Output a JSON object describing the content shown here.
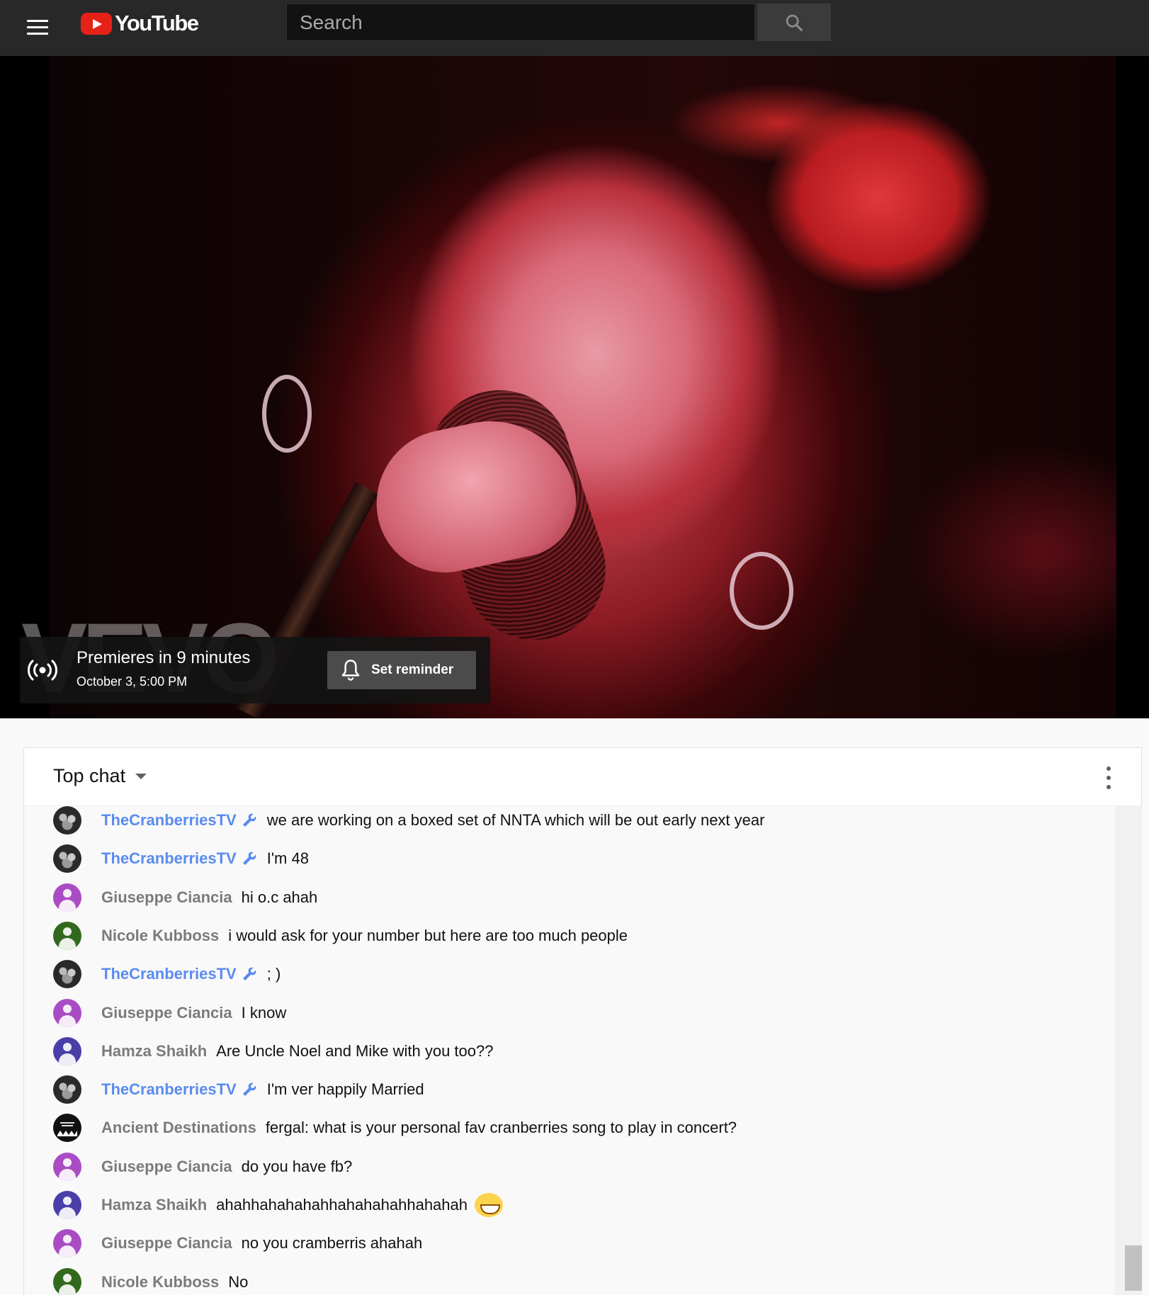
{
  "masthead": {
    "logo_text": "YouTube",
    "search_placeholder": "Search"
  },
  "player": {
    "watermark": "VEVO",
    "premiere": {
      "title": "Premieres in 9 minutes",
      "date": "October 3, 5:00 PM",
      "reminder_label": "Set reminder"
    }
  },
  "chat": {
    "mode_label": "Top chat",
    "messages": [
      {
        "author": "TheCranberriesTV",
        "owner": true,
        "avatar": "band",
        "text": "we are working on a boxed set of NNTA which will be out early next year"
      },
      {
        "author": "TheCranberriesTV",
        "owner": true,
        "avatar": "band",
        "text": "I'm 48"
      },
      {
        "author": "Giuseppe Ciancia",
        "owner": false,
        "avatar": "#a94cc4",
        "text": "hi o.c ahah"
      },
      {
        "author": "Nicole Kubboss",
        "owner": false,
        "avatar": "#33691e",
        "text": "i would ask for your number but here are too much people"
      },
      {
        "author": "TheCranberriesTV",
        "owner": true,
        "avatar": "band",
        "text": "; )"
      },
      {
        "author": "Giuseppe Ciancia",
        "owner": false,
        "avatar": "#a94cc4",
        "text": "I know"
      },
      {
        "author": "Hamza Shaikh",
        "owner": false,
        "avatar": "#4a3fa8",
        "text": "Are Uncle Noel and Mike with you too??"
      },
      {
        "author": "TheCranberriesTV",
        "owner": true,
        "avatar": "band",
        "text": "I'm ver happily Married"
      },
      {
        "author": "Ancient Destinations",
        "owner": false,
        "avatar": "ancient",
        "text": "fergal: what is your personal fav cranberries song to play in concert?"
      },
      {
        "author": "Giuseppe Ciancia",
        "owner": false,
        "avatar": "#a94cc4",
        "text": "do you have fb?"
      },
      {
        "author": "Hamza Shaikh",
        "owner": false,
        "avatar": "#4a3fa8",
        "text": "ahahhahahahahhahahahahhahahah",
        "emoji": "grinning-squinting-face"
      },
      {
        "author": "Giuseppe Ciancia",
        "owner": false,
        "avatar": "#a94cc4",
        "text": "no you cramberris ahahah"
      },
      {
        "author": "Nicole Kubboss",
        "owner": false,
        "avatar": "#33691e",
        "text": "No"
      }
    ]
  },
  "colors": {
    "brand_red": "#e62117",
    "owner_blue": "#5a8bf0",
    "masthead_bg": "#282828"
  }
}
